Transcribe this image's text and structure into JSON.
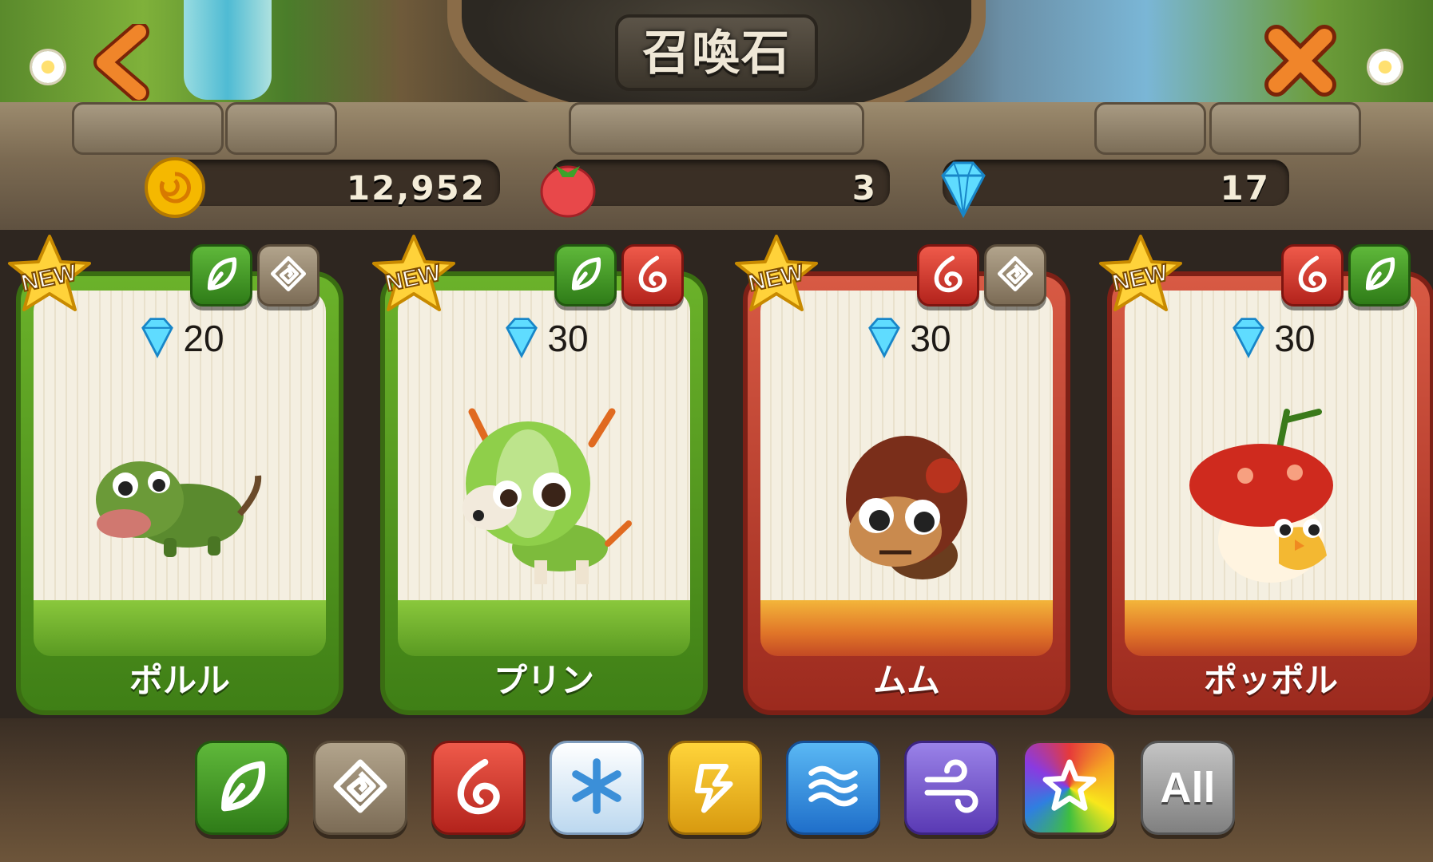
{
  "header": {
    "title": "召喚石",
    "back_icon": "back-arrow-icon",
    "close_icon": "close-x-icon"
  },
  "currency": {
    "gold": {
      "icon": "gold-coin-icon",
      "value": "12,952"
    },
    "fruit": {
      "icon": "strawberry-icon",
      "value": "3"
    },
    "gems": {
      "icon": "diamond-icon",
      "value": "17"
    }
  },
  "cards": [
    {
      "badge": "NEW",
      "elements": [
        "leaf",
        "earth"
      ],
      "price": "20",
      "name": "ポルル",
      "theme": "green",
      "creature_icon": "green-chameleon-icon"
    },
    {
      "badge": "NEW",
      "elements": [
        "leaf",
        "fire"
      ],
      "price": "30",
      "name": "プリン",
      "theme": "green",
      "creature_icon": "green-fawn-icon"
    },
    {
      "badge": "NEW",
      "elements": [
        "fire",
        "earth"
      ],
      "price": "30",
      "name": "ムム",
      "theme": "red",
      "creature_icon": "mole-creature-icon"
    },
    {
      "badge": "NEW",
      "elements": [
        "fire",
        "leaf"
      ],
      "price": "30",
      "name": "ポッポル",
      "theme": "red",
      "creature_icon": "mushroom-chick-icon"
    }
  ],
  "filters": [
    {
      "element": "leaf",
      "icon": "leaf-icon"
    },
    {
      "element": "earth",
      "icon": "earth-spiral-icon"
    },
    {
      "element": "fire",
      "icon": "fire-icon"
    },
    {
      "element": "ice",
      "icon": "ice-snowflake-icon"
    },
    {
      "element": "thunder",
      "icon": "thunder-bolt-icon"
    },
    {
      "element": "water",
      "icon": "water-waves-icon"
    },
    {
      "element": "wind",
      "icon": "wind-swirl-icon"
    },
    {
      "element": "rainbow",
      "icon": "rainbow-star-icon"
    },
    {
      "element": "all",
      "label": "All"
    }
  ],
  "colors": {
    "green_card": "#4f9a1e",
    "red_card": "#c8402e",
    "gold": "#f5b800",
    "gem": "#36c6f0"
  }
}
